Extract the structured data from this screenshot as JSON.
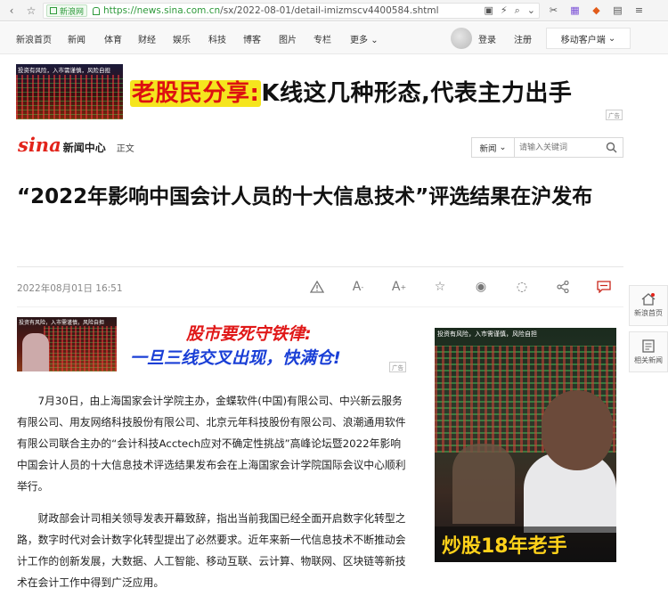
{
  "browser": {
    "site_badge": "新浪网",
    "url_host": "https://news.sina.com.cn",
    "url_path": "/sx/2022-08-01/detail-imizmscv4400584.shtml"
  },
  "nav": {
    "items": [
      "新浪首页",
      "新闻",
      "体育",
      "财经",
      "娱乐",
      "科技",
      "博客",
      "图片",
      "专栏",
      "更多"
    ],
    "login": "登录",
    "register": "注册",
    "mobile": "移动客户端"
  },
  "top_ad": {
    "thumb_caption": "投资有风险，入市需谨慎，风险自担",
    "highlight": "老股民分享:",
    "rest": "K线这几种形态,代表主力出手",
    "tag": "广告"
  },
  "header": {
    "brand": "sina",
    "section": "新闻中心",
    "sub": "正文",
    "search_select": "新闻",
    "search_placeholder": "请输入关键词"
  },
  "article": {
    "title": "“2022年影响中国会计人员的十大信息技术”评选结果在沪发布",
    "date": "2022年08月01日 16:51",
    "paragraphs": [
      "7月30日，由上海国家会计学院主办，金蝶软件(中国)有限公司、中兴新云服务有限公司、用友网络科技股份有限公司、北京元年科技股份有限公司、浪潮通用软件有限公司联合主办的“会计科技Acctech应对不确定性挑战”高峰论坛暨2022年影响中国会计人员的十大信息技术评选结果发布会在上海国家会计学院国际会议中心顺利举行。",
      "财政部会计司相关领导发表开幕致辞，指出当前我国已经全面开启数字化转型之路，数字时代对会计数字化转型提出了必然要求。近年来新一代信息技术不断推动会计工作的创新发展，大数据、人工智能、移动互联、云计算、物联网、区块链等新技术在会计工作中得到广泛应用。"
    ]
  },
  "side": {
    "home": "新浪首页",
    "related": "相关新闻"
  },
  "mid_ad": {
    "thumb_caption": "投资有风险，入市需谨慎，风险自担",
    "line1": "股市要死守铁律:",
    "line2": "一旦三线交叉出现，快满仓!",
    "tag": "广告"
  },
  "right_ad": {
    "caption": "投资有风险，入市需谨慎，风险自担",
    "slogan": "炒股18年老手"
  },
  "colors": {
    "brand_red": "#e2231a",
    "url_green": "#2e9a3b"
  }
}
